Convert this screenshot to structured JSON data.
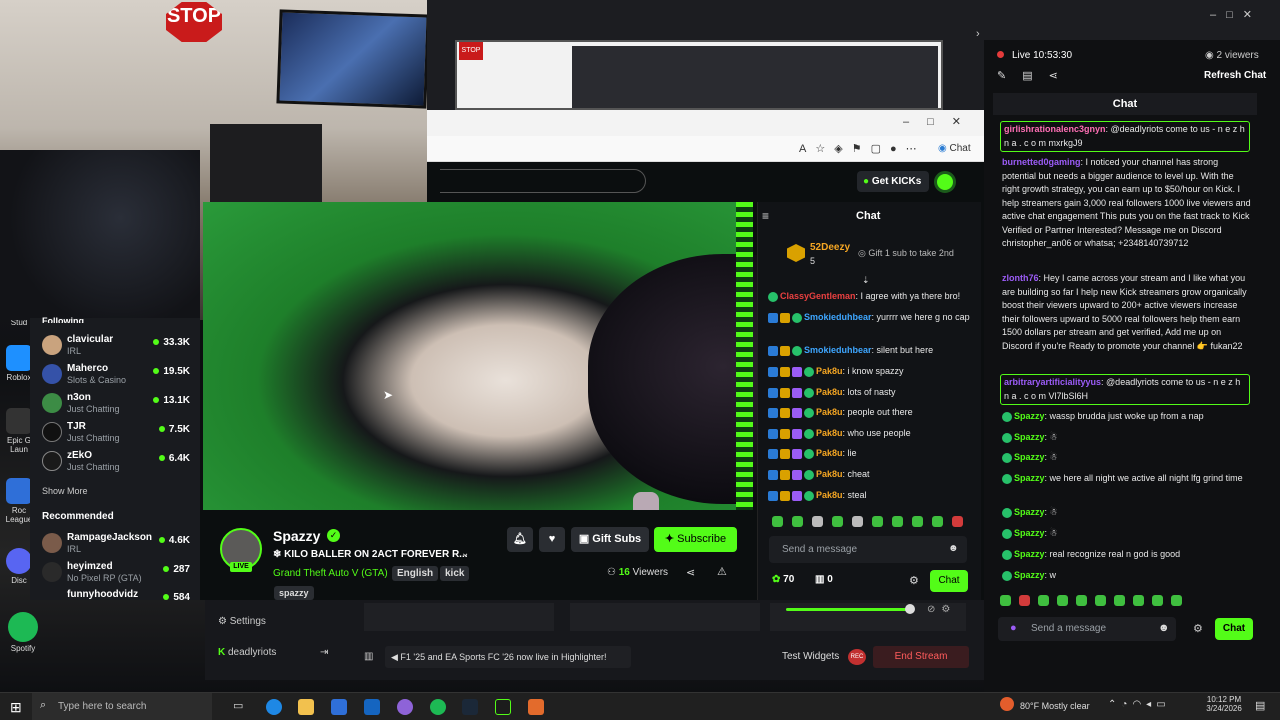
{
  "desktop": {
    "icons": [
      {
        "label": "Stud"
      },
      {
        "label": "Roblox"
      },
      {
        "label": "Epic G Laun"
      },
      {
        "label": "Roc League"
      },
      {
        "label": "Disc"
      },
      {
        "label": "Spotify"
      }
    ]
  },
  "webcam": {
    "sign": "STOP"
  },
  "kick": {
    "get_kicks": "Get KICKs",
    "sidebar": {
      "following_label": "Following",
      "following": [
        {
          "name": "clavicular",
          "category": "IRL",
          "viewers": "33.3K"
        },
        {
          "name": "Maherco",
          "category": "Slots & Casino",
          "viewers": "19.5K"
        },
        {
          "name": "n3on",
          "category": "Just Chatting",
          "viewers": "13.1K"
        },
        {
          "name": "TJR",
          "category": "Just Chatting",
          "viewers": "7.5K"
        },
        {
          "name": "zEkO",
          "category": "Just Chatting",
          "viewers": "6.4K"
        }
      ],
      "show_more": "Show More",
      "recommended_label": "Recommended",
      "recommended": [
        {
          "name": "RampageJackson",
          "category": "IRL",
          "viewers": "4.6K"
        },
        {
          "name": "heyimzed",
          "category": "No Pixel RP (GTA)",
          "viewers": "287"
        },
        {
          "name": "funnyhoodvidz",
          "category": "",
          "viewers": "584"
        }
      ]
    },
    "stream": {
      "channel": "Spazzy",
      "title": "❄ KILO BALLER ON 2ACT FOREVER R...",
      "category": "Grand Theft Auto V (GTA)",
      "tags": [
        "English",
        "kick",
        "spazzy"
      ],
      "live": "LIVE",
      "viewers": "16",
      "viewers_label": "Viewers",
      "gift_subs": "Gift Subs",
      "subscribe": "Subscribe"
    },
    "chat": {
      "title": "Chat",
      "pinned_user": "52Deezy",
      "pinned_level": "5",
      "gift_prompt": "Gift 1 sub to take 2nd",
      "messages": [
        {
          "user": "ClassyGentleman",
          "text": ": I agree with ya there bro!",
          "color": "#e94040"
        },
        {
          "user": "Smokieduhbear",
          "text": ": yurrrr we here g no cap",
          "color": "#3ea6ff"
        },
        {
          "user": "Smokieduhbear",
          "text": ": silent but here",
          "color": "#3ea6ff"
        },
        {
          "user": "Pak8u",
          "text": ": i know spazzy",
          "color": "#f5a623"
        },
        {
          "user": "Pak8u",
          "text": ": lots of nasty",
          "color": "#f5a623"
        },
        {
          "user": "Pak8u",
          "text": ": people out there",
          "color": "#f5a623"
        },
        {
          "user": "Pak8u",
          "text": ": who use people",
          "color": "#f5a623"
        },
        {
          "user": "Pak8u",
          "text": ": lie",
          "color": "#f5a623"
        },
        {
          "user": "Pak8u",
          "text": ": cheat",
          "color": "#f5a623"
        },
        {
          "user": "Pak8u",
          "text": ": steal",
          "color": "#f5a623"
        }
      ],
      "input_placeholder": "Send a message",
      "points": "70",
      "gifts": "0",
      "send": "Chat"
    }
  },
  "edge": {
    "chat_label": "Chat"
  },
  "obs": {
    "settings": "Settings",
    "account": "deadlyriots",
    "highlighter": "F1 '25 and EA Sports FC '26 now live in Highlighter!",
    "test_widgets": "Test Widgets",
    "rec": "REC",
    "end_stream": "End Stream"
  },
  "rightpanel": {
    "live_label": "Live 10:53:30",
    "viewers": "2 viewers",
    "refresh_chat": "Refresh Chat",
    "chat_title": "Chat",
    "messages": [
      {
        "user": "girlishrationalenc3gnyn",
        "text": ": @deadlyriots come to us - n e z h n a . c o m mxrkgJ9",
        "highlight": true
      },
      {
        "user": "burnetted0gaming",
        "text": ": I noticed your channel has strong potential but needs a bigger audience to level up. With the right growth strategy, you can earn up to $50/hour on Kick. I help streamers gain 3,000 real followers 1000 live viewers and active chat engagement This puts you on the fast track to Kick Verified or Partner Interested? Message me on Discord christopher_an06 or whatsa; +2348140739712",
        "highlight": false
      },
      {
        "user": "zlonth76",
        "text": ": Hey I came across your stream and I like what you are building so far I help new Kick streamers grow organically boost their viewers upward to 200+ active viewers increase their followers upward to 5000 real followers help them earn 1500 dollars per stream and get verified, Add me up on Discord if you're Ready to promote your channel 👉 fukan22",
        "highlight": false
      },
      {
        "user": "arbitraryartificialityyus",
        "text": ": @deadlyriots come to us - n e z h n a . c o m Vl7lbSl6H",
        "highlight": true
      }
    ],
    "spazzy_messages": [
      ": wassp brudda just woke up from a nap",
      ":",
      ":",
      ": we here all night we active all night lfg grind time",
      ":",
      ":",
      ": real recognize real n god is good",
      ": w"
    ],
    "spazzy_name": "Spazzy",
    "input_placeholder": "Send a message",
    "send": "Chat"
  },
  "taskbar": {
    "search_placeholder": "Type here to search",
    "weather": "80°F  Mostly clear",
    "time": "10:12 PM",
    "date": "3/24/2026"
  }
}
